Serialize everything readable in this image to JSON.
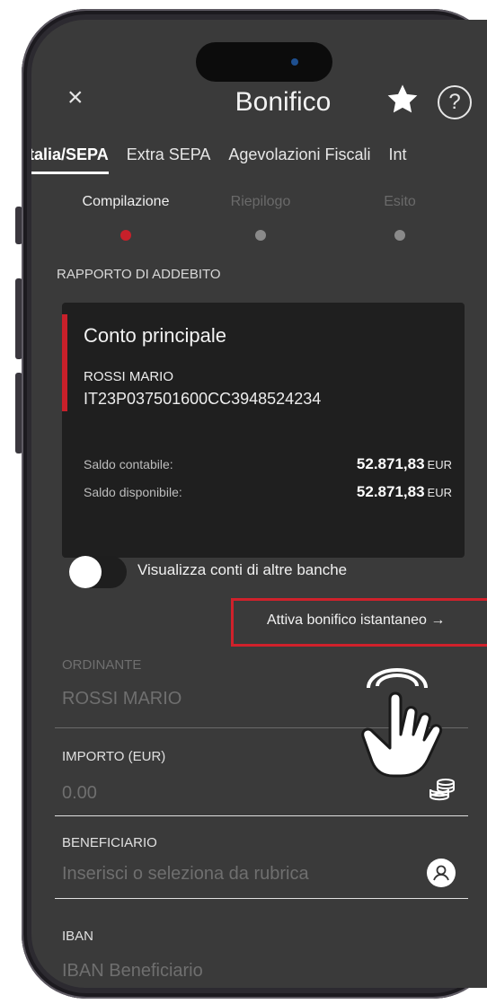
{
  "header": {
    "close_glyph": "×",
    "title": "Bonifico",
    "star_icon": "star-icon",
    "help_glyph": "?"
  },
  "tabs": [
    {
      "label": "Italia/SEPA",
      "active": true
    },
    {
      "label": "Extra SEPA",
      "active": false
    },
    {
      "label": "Agevolazioni Fiscali",
      "active": false
    },
    {
      "label": "Int",
      "active": false
    }
  ],
  "stepper": [
    {
      "label": "Compilazione",
      "active": true
    },
    {
      "label": "Riepilogo",
      "active": false
    },
    {
      "label": "Esito",
      "active": false
    }
  ],
  "debit": {
    "section_label": "RAPPORTO DI ADDEBITO",
    "account_name": "Conto principale",
    "holder": "ROSSI MARIO",
    "iban": "IT23P037501600CC3948524234",
    "saldo_contabile_label": "Saldo contabile:",
    "saldo_contabile_value": "52.871,83",
    "saldo_disponibile_label": "Saldo disponibile:",
    "saldo_disponibile_value": "52.871,83",
    "currency": "EUR"
  },
  "toggle": {
    "label": "Visualizza conti di altre banche",
    "on": false
  },
  "instant_link": {
    "label": "Attiva bonifico istantaneo →"
  },
  "form": {
    "ordinante_label": "ORDINANTE",
    "ordinante_value": "ROSSI MARIO",
    "importo_label": "IMPORTO (EUR)",
    "importo_placeholder": "0.00",
    "beneficiario_label": "BENEFICIARIO",
    "beneficiario_placeholder": "Inserisci o seleziona da rubrica",
    "iban_label": "IBAN",
    "iban_placeholder": "IBAN Beneficiario"
  },
  "colors": {
    "accent": "#c8202a",
    "background": "#3a3a3a",
    "card": "#1f1f1f"
  }
}
